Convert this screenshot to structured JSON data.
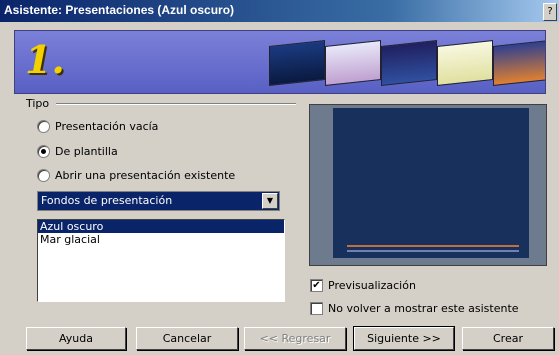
{
  "window": {
    "title": "Asistente: Presentaciones (Azul oscuro)",
    "help_glyph": "?"
  },
  "banner": {
    "step": "1."
  },
  "tipo": {
    "legend": "Tipo",
    "options": [
      {
        "label": "Presentación vacía",
        "checked": false
      },
      {
        "label": "De plantilla",
        "checked": true
      },
      {
        "label": "Abrir una presentación existente",
        "checked": false
      }
    ]
  },
  "category_select": {
    "value": "Fondos de presentación"
  },
  "templates": {
    "items": [
      "Azul oscuro",
      "Mar glacial"
    ],
    "selected": "Azul oscuro"
  },
  "options": {
    "preview_label": "Previsualización",
    "preview_checked": true,
    "dont_show_label": "No volver a mostrar este asistente",
    "dont_show_checked": false
  },
  "buttons": {
    "help": "Ayuda",
    "cancel": "Cancelar",
    "back": "<< Regresar",
    "next": "Siguiente >>",
    "create": "Crear"
  }
}
